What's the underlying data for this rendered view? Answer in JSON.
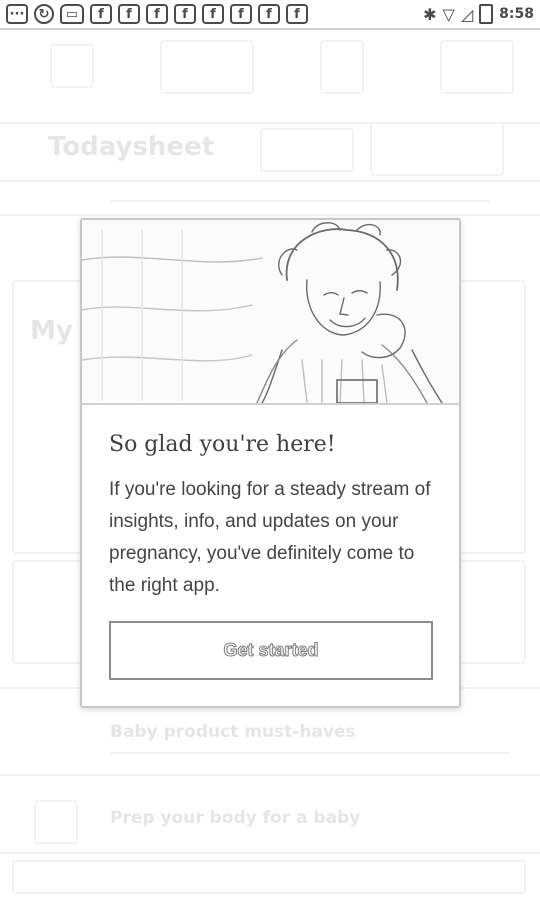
{
  "status_bar": {
    "time": "8:58",
    "notification_letter": "f"
  },
  "background": {
    "header_title": "Todaysheet",
    "row_title": "My Baby",
    "list_line_1": "Baby product must-haves",
    "list_line_2": "Prep your body for a baby"
  },
  "dialog": {
    "title": "So glad you're here!",
    "body": "If you're looking for a steady stream of insights, info, and updates on your pregnancy, you've definitely come to the right app.",
    "cta_label": "Get started"
  }
}
